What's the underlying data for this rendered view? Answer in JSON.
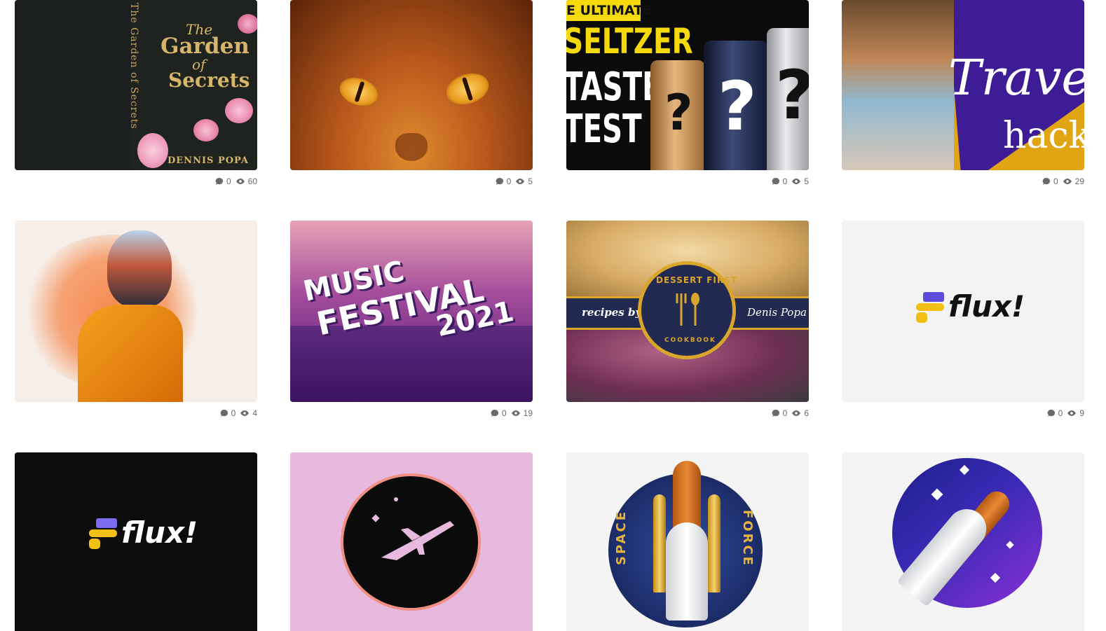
{
  "cards": [
    {
      "art": {
        "line1": "The",
        "line2": "Garden",
        "line3": "of",
        "line4": "Secrets",
        "author": "DENNIS POPA",
        "spine": "The Garden of Secrets"
      },
      "comments": "0",
      "views": "60"
    },
    {
      "art": {},
      "comments": "0",
      "views": "5"
    },
    {
      "art": {
        "banner": "E ULTIMATE",
        "line1": "SELTZER",
        "line2": "TASTE",
        "line3": "TEST",
        "q": "?"
      },
      "comments": "0",
      "views": "5"
    },
    {
      "art": {
        "line1": "Travel",
        "line2": "hack"
      },
      "comments": "0",
      "views": "29"
    },
    {
      "art": {},
      "comments": "0",
      "views": "4"
    },
    {
      "art": {
        "line1": "MUSIC",
        "line2": "FESTIVAL",
        "line3": "2021"
      },
      "comments": "0",
      "views": "19"
    },
    {
      "art": {
        "left": "recipes by:",
        "right": "Denis Popa",
        "ring_top": "DESSERT FIRST",
        "ring_bottom": "COOKBOOK"
      },
      "comments": "0",
      "views": "6"
    },
    {
      "art": {
        "logo": "flux!"
      },
      "comments": "0",
      "views": "9"
    },
    {
      "art": {
        "logo": "flux!"
      },
      "comments": "",
      "views": ""
    },
    {
      "art": {},
      "comments": "",
      "views": ""
    },
    {
      "art": {
        "left": "SPACE",
        "right": "FORCE"
      },
      "comments": "",
      "views": ""
    },
    {
      "art": {},
      "comments": "",
      "views": ""
    }
  ],
  "icons": {
    "comment": "comment-bubble-icon",
    "views": "eye-icon"
  }
}
